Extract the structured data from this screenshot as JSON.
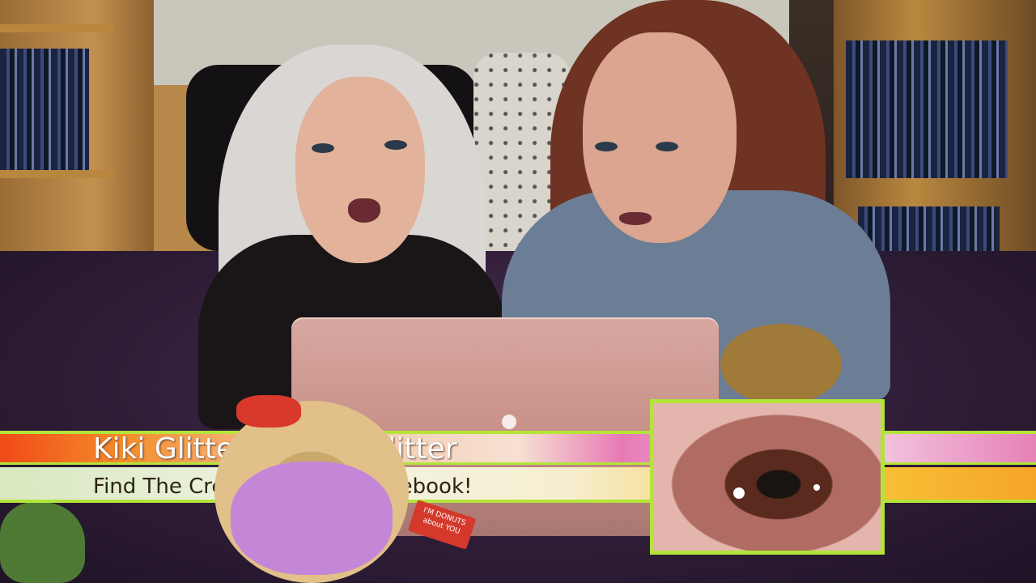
{
  "lower_third": {
    "name_line": "Kiki Glitter – Trans Glitter",
    "tagline": "Find The Creeper Files on Facebook!"
  },
  "plush_tag": {
    "text": "I'M DONUTS about YOU"
  },
  "colors": {
    "banner_accent": "#b3e43a",
    "banner_orange": "#f04a18",
    "banner_pink": "#e77ab6",
    "banner_yellow": "#f8c73c"
  }
}
